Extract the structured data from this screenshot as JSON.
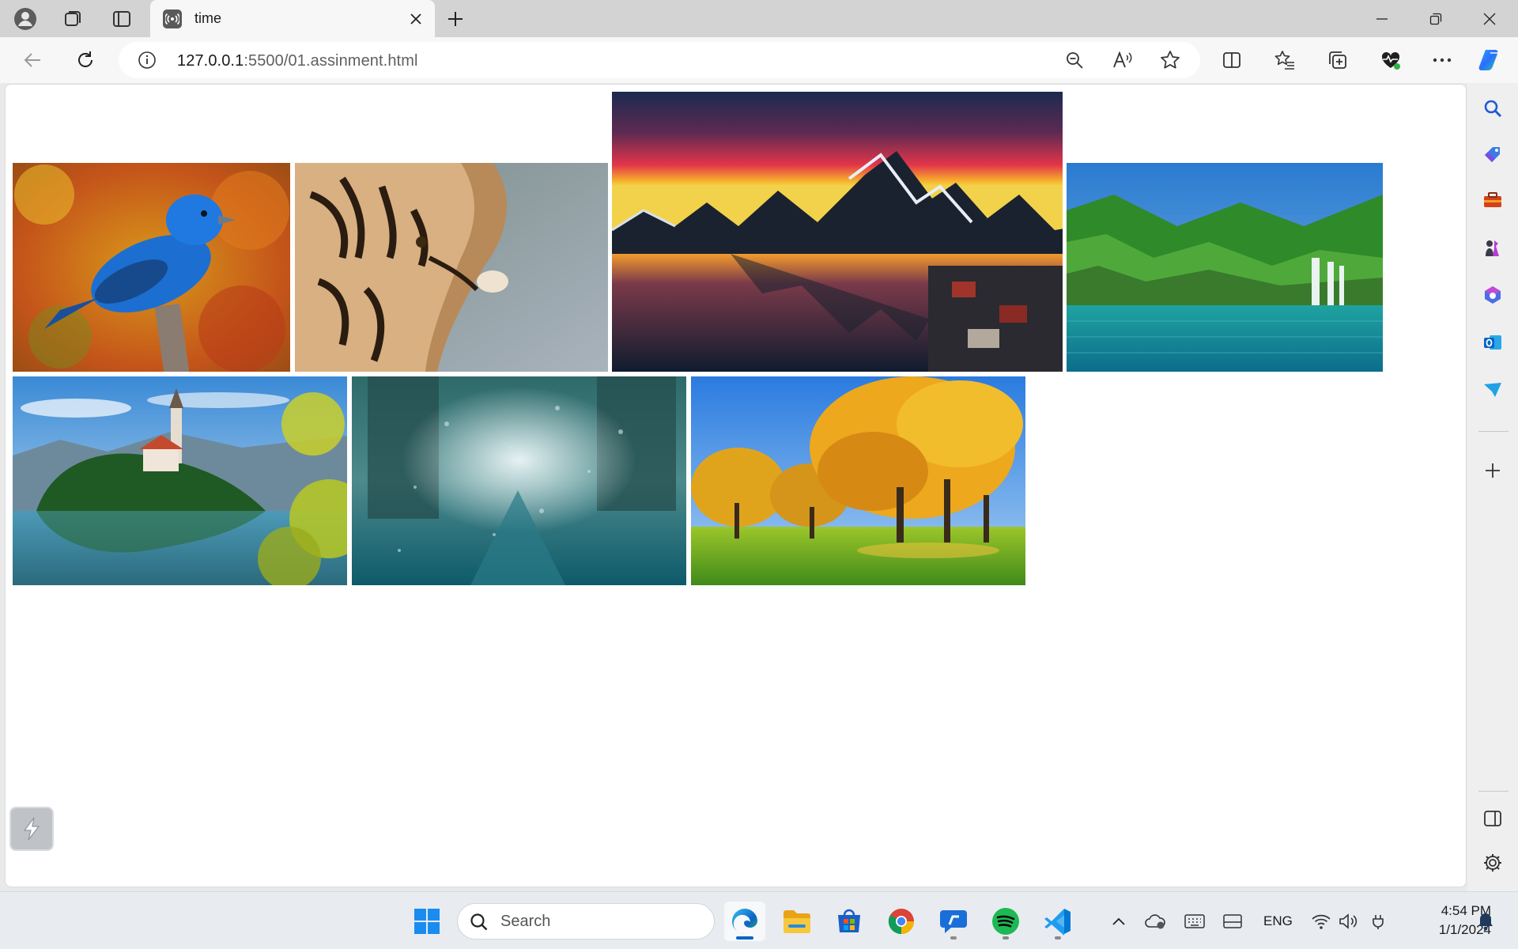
{
  "browser": {
    "tab": {
      "title": "time"
    },
    "address": {
      "host": "127.0.0.1",
      "path": ":5500/01.assinment.html"
    }
  },
  "gallery": {
    "images": [
      {
        "name": "blue-bird-photo",
        "subject": "blue bird"
      },
      {
        "name": "tiger-photo",
        "subject": "tiger"
      },
      {
        "name": "mountain-sunset-photo",
        "subject": "mountain lake at sunset"
      },
      {
        "name": "waterfall-lake-photo",
        "subject": "waterfall lake"
      },
      {
        "name": "island-church-photo",
        "subject": "island church on lake"
      },
      {
        "name": "rainy-street-photo",
        "subject": "rainy street"
      },
      {
        "name": "autumn-trees-photo",
        "subject": "autumn trees"
      }
    ]
  },
  "taskbar": {
    "search_label": "Search",
    "language": "ENG",
    "time": "4:54 PM",
    "date": "1/1/2024"
  },
  "colors": {
    "edge_accent": "#0a64c8",
    "spotify_green": "#1db954",
    "vscode_blue": "#0078d4"
  }
}
